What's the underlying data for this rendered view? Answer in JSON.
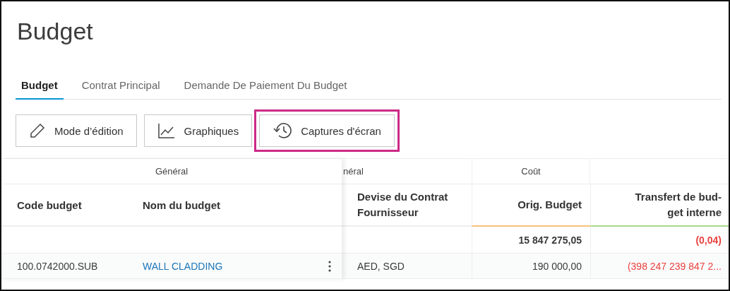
{
  "page_title": "Budget",
  "tabs": [
    {
      "label": "Budget",
      "selected": true
    },
    {
      "label": "Contrat Principal",
      "selected": false
    },
    {
      "label": "Demande De Paiement Du Budget",
      "selected": false
    }
  ],
  "toolbar": [
    {
      "label": "Mode d’édition"
    },
    {
      "label": "Graphiques"
    },
    {
      "label": "Captures d'écran",
      "highlighted": true
    }
  ],
  "table": {
    "frozen_group": "Général",
    "groups": [
      "néral",
      "Coût"
    ],
    "frozen_columns": [
      "Code budget",
      "Nom du budget"
    ],
    "columns": [
      {
        "label": "Devise du Contrat\nFournisseur",
        "kind": "text"
      },
      {
        "label": "Orig. Budget",
        "kind": "amount"
      },
      {
        "label": "Transfert de bud-\nget interne",
        "kind": "amount"
      }
    ],
    "rows": [
      {
        "kind": "total",
        "cells": [
          null,
          {
            "text": "15 847 275,05",
            "negative": false
          },
          {
            "text": "(0,04)",
            "negative": true
          }
        ]
      },
      {
        "kind": "data",
        "code": "100.0742000.SUB",
        "name": "WALL CLADDING",
        "cells": [
          {
            "text": "AED, SGD",
            "negative": false
          },
          {
            "text": "190 000,00",
            "negative": false
          },
          {
            "text": "(398 247 239 847 2...",
            "negative": true
          }
        ]
      }
    ]
  }
}
